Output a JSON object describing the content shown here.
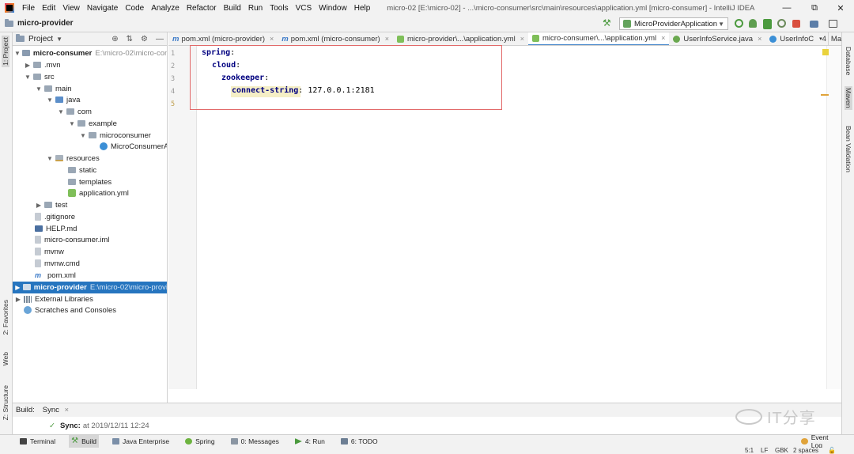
{
  "menubar": {
    "items": [
      "File",
      "Edit",
      "View",
      "Navigate",
      "Code",
      "Analyze",
      "Refactor",
      "Build",
      "Run",
      "Tools",
      "VCS",
      "Window",
      "Help"
    ],
    "window_title": "micro-02 [E:\\micro-02] - ...\\micro-consumer\\src\\main\\resources\\application.yml [micro-consumer] - IntelliJ IDEA",
    "controls": [
      "—",
      "⧉",
      "✕"
    ]
  },
  "navbar": {
    "project_name": "micro-provider",
    "run_config": "MicroProviderApplication"
  },
  "left_strip": {
    "project_tab": "1: Project",
    "favorites_tab": "2: Favorites",
    "web_tab": "Web",
    "structure_tab": "Z: Structure"
  },
  "right_strip": {
    "database_tab": "Database",
    "maven_tab": "Maven",
    "bean_validation_tab": "Bean Validation"
  },
  "project_panel": {
    "title": "Project",
    "rows": [
      {
        "label": "micro-consumer",
        "path": "E:\\micro-02\\micro-con",
        "bold": true
      },
      {
        "label": ".mvn"
      },
      {
        "label": "src"
      },
      {
        "label": "main"
      },
      {
        "label": "java"
      },
      {
        "label": "com"
      },
      {
        "label": "example"
      },
      {
        "label": "microconsumer"
      },
      {
        "label": "MicroConsumerA"
      },
      {
        "label": "resources"
      },
      {
        "label": "static"
      },
      {
        "label": "templates"
      },
      {
        "label": "application.yml"
      },
      {
        "label": "test"
      },
      {
        "label": ".gitignore"
      },
      {
        "label": "HELP.md"
      },
      {
        "label": "micro-consumer.iml"
      },
      {
        "label": "mvnw"
      },
      {
        "label": "mvnw.cmd"
      },
      {
        "label": "pom.xml"
      },
      {
        "label": "micro-provider",
        "path": "E:\\micro-02\\micro-provi",
        "bold": true
      },
      {
        "label": "External Libraries"
      },
      {
        "label": "Scratches and Consoles"
      }
    ]
  },
  "editor_tabs": [
    {
      "label": "pom.xml (micro-provider)"
    },
    {
      "label": "pom.xml (micro-consumer)"
    },
    {
      "label": "micro-provider\\...\\application.yml"
    },
    {
      "label": "micro-consumer\\...\\application.yml",
      "active": true
    },
    {
      "label": "UserInfoService.java"
    },
    {
      "label": "UserInfoC"
    }
  ],
  "editor_tab_overflow": "4",
  "editor_tab_extra": "Mav",
  "editor": {
    "line_numbers": [
      "1",
      "2",
      "3",
      "4",
      "5"
    ],
    "lines": [
      {
        "key": "spring",
        "sep": ":",
        "value": ""
      },
      {
        "key": "cloud",
        "sep": ":",
        "value": ""
      },
      {
        "key": "zookeeper",
        "sep": ":",
        "value": ""
      },
      {
        "key": "connect-string",
        "sep": ": ",
        "value": "127.0.0.1:2181"
      },
      {
        "key": "",
        "sep": "",
        "value": ""
      }
    ]
  },
  "build_panel": {
    "label": "Build:",
    "tab": "Sync",
    "status_label": "Sync:",
    "status_time": "at 2019/12/11 12:24"
  },
  "watermark": {
    "text": "IT分享"
  },
  "bottom_tools": [
    {
      "label": "Terminal"
    },
    {
      "label": "Build",
      "active": true
    },
    {
      "label": "Java Enterprise"
    },
    {
      "label": "Spring"
    },
    {
      "label": "0: Messages"
    },
    {
      "label": "4: Run"
    },
    {
      "label": "6: TODO"
    }
  ],
  "event_log": "Event Log",
  "status_bar": {
    "position": "5:1",
    "line_sep": "LF",
    "encoding": "GBK",
    "indent": "2 spaces"
  }
}
